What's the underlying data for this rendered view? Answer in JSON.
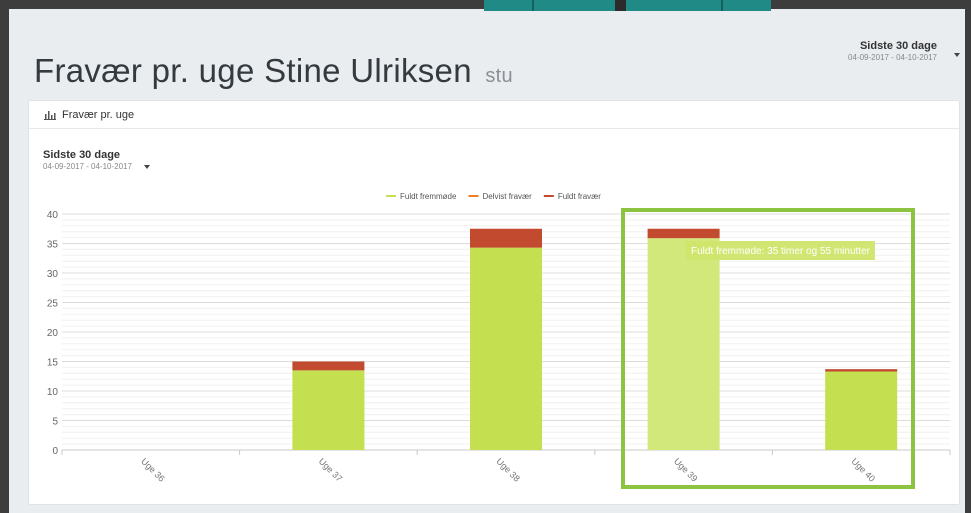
{
  "header": {
    "title": "Fravær pr. uge Stine Ulriksen",
    "subtitle": "stu",
    "range_label": "Sidste 30 dage",
    "range_dates": "04-09-2017 - 04-10-2017"
  },
  "panel": {
    "heading": "Fravær pr. uge",
    "range_label": "Sidste 30 dage",
    "range_dates": "04-09-2017 - 04-10-2017"
  },
  "icons": {
    "panel_icon": "bar-chart-icon",
    "dropdown": "caret-down-icon"
  },
  "colors": {
    "fuldt_fremmode": "#c4df4f",
    "delvist_fravaer": "#f07e26",
    "fuldt_fravaer": "#c24a2f",
    "highlight_bar": "#d2e87a",
    "tooltip_bg": "#cfe56a",
    "highlight_box": "#8cc341"
  },
  "chart_data": {
    "type": "bar",
    "stacked": true,
    "categories": [
      "Uge 36",
      "Uge 37",
      "Uge 38",
      "Uge 39",
      "Uge 40"
    ],
    "series": [
      {
        "name": "Fuldt fremmøde",
        "values": [
          0,
          13.5,
          34.3,
          35.9,
          13.3
        ]
      },
      {
        "name": "Delvist fravær",
        "values": [
          0,
          0,
          0,
          0,
          0
        ]
      },
      {
        "name": "Fuldt fravær",
        "values": [
          0,
          1.5,
          3.2,
          1.6,
          0.4
        ]
      }
    ],
    "yticks": [
      "0",
      "5",
      "10",
      "15",
      "20",
      "25",
      "30",
      "35",
      "40"
    ],
    "ylim": [
      0,
      40
    ],
    "legend_position": "top-center",
    "grid": true,
    "tooltip": {
      "category": "Uge 39",
      "text": "Fuldt fremmøde: 35 timer og 55 minutter"
    }
  }
}
